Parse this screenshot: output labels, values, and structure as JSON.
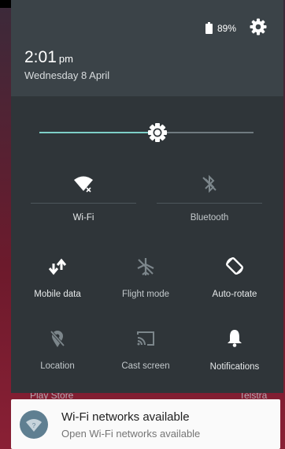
{
  "status": {
    "battery_percent": "89%"
  },
  "header": {
    "time": "2:01",
    "ampm": "pm",
    "date": "Wednesday 8 April"
  },
  "brightness": {
    "level": 0.55
  },
  "tiles": {
    "wifi": {
      "label": "Wi-Fi",
      "state": "on"
    },
    "bluetooth": {
      "label": "Bluetooth",
      "state": "off"
    },
    "mobile_data": {
      "label": "Mobile data",
      "state": "on"
    },
    "flight_mode": {
      "label": "Flight mode",
      "state": "off"
    },
    "auto_rotate": {
      "label": "Auto-rotate",
      "state": "on"
    },
    "location": {
      "label": "Location",
      "state": "off"
    },
    "cast_screen": {
      "label": "Cast screen",
      "state": "off"
    },
    "notifications": {
      "label": "Notifications",
      "state": "on"
    }
  },
  "background_labels": {
    "left": "Play Store",
    "right": "Telstra"
  },
  "notification": {
    "title": "Wi-Fi networks available",
    "subtitle": "Open Wi-Fi networks available",
    "icon": "wifi-question-icon"
  },
  "colors": {
    "accent": "#7ecfc7",
    "shade": "#2f3539",
    "header": "#3b4348"
  }
}
